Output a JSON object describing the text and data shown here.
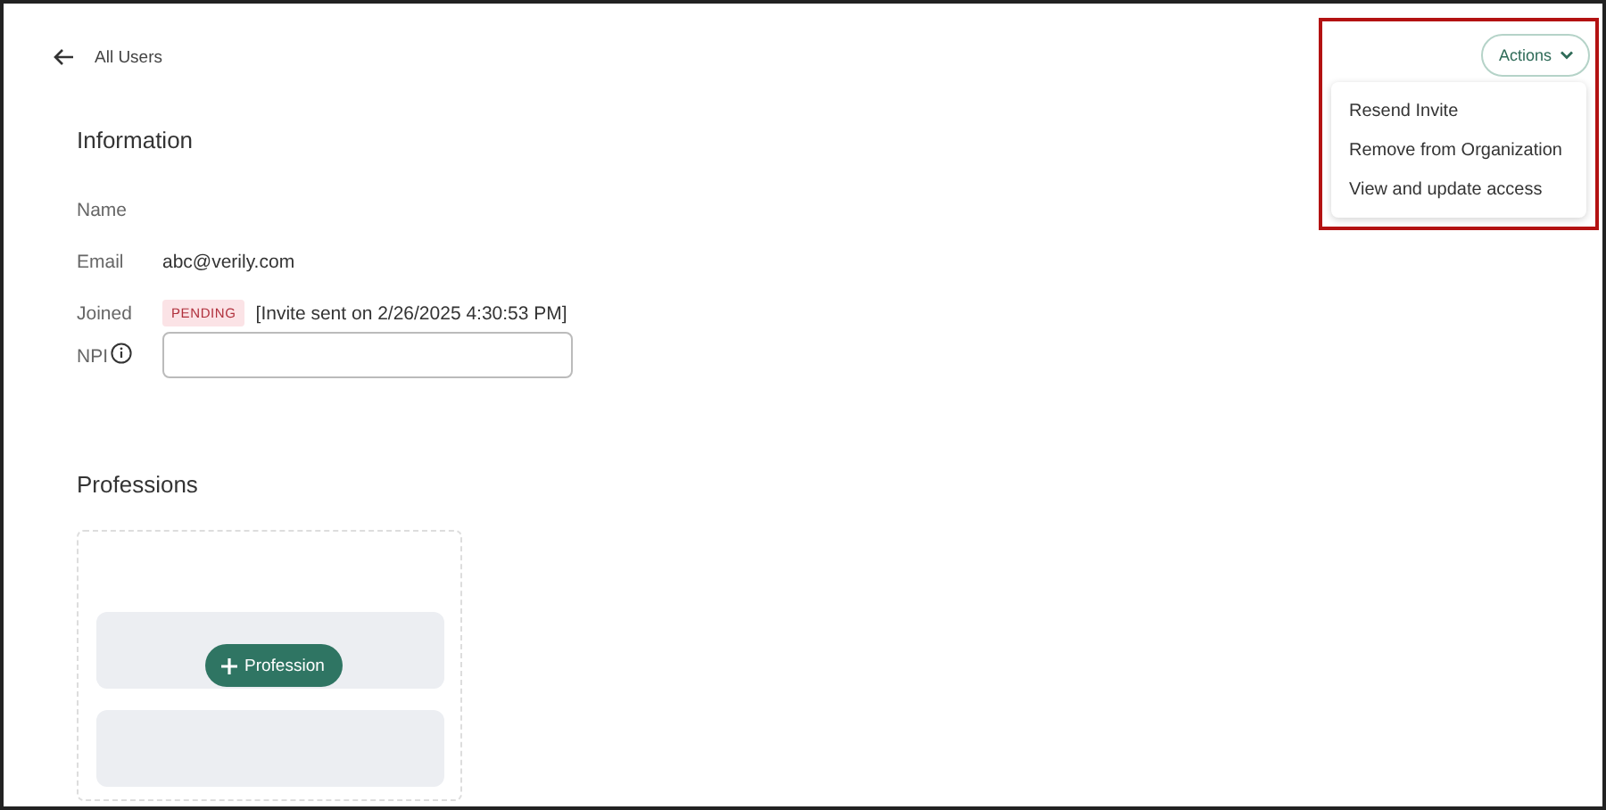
{
  "back_link": {
    "label": "All Users"
  },
  "actions_button": {
    "label": "Actions",
    "expanded": true
  },
  "actions_menu": {
    "items": [
      {
        "label": "Resend Invite"
      },
      {
        "label": "Remove from Organization"
      },
      {
        "label": "View and update access"
      }
    ]
  },
  "information": {
    "title": "Information",
    "fields": [
      {
        "label": "Name",
        "kind": "text"
      },
      {
        "label": "Email",
        "kind": "text",
        "value": "abc@verily.com"
      },
      {
        "label": "Joined",
        "kind": "status",
        "badge": "PENDING",
        "value": "[Invite sent on 2/26/2025 4:30:53 PM]"
      },
      {
        "label": "NPI",
        "kind": "input",
        "info": true
      }
    ]
  },
  "professions": {
    "title": "Professions",
    "add_button": "Profession"
  },
  "highlight": true
}
